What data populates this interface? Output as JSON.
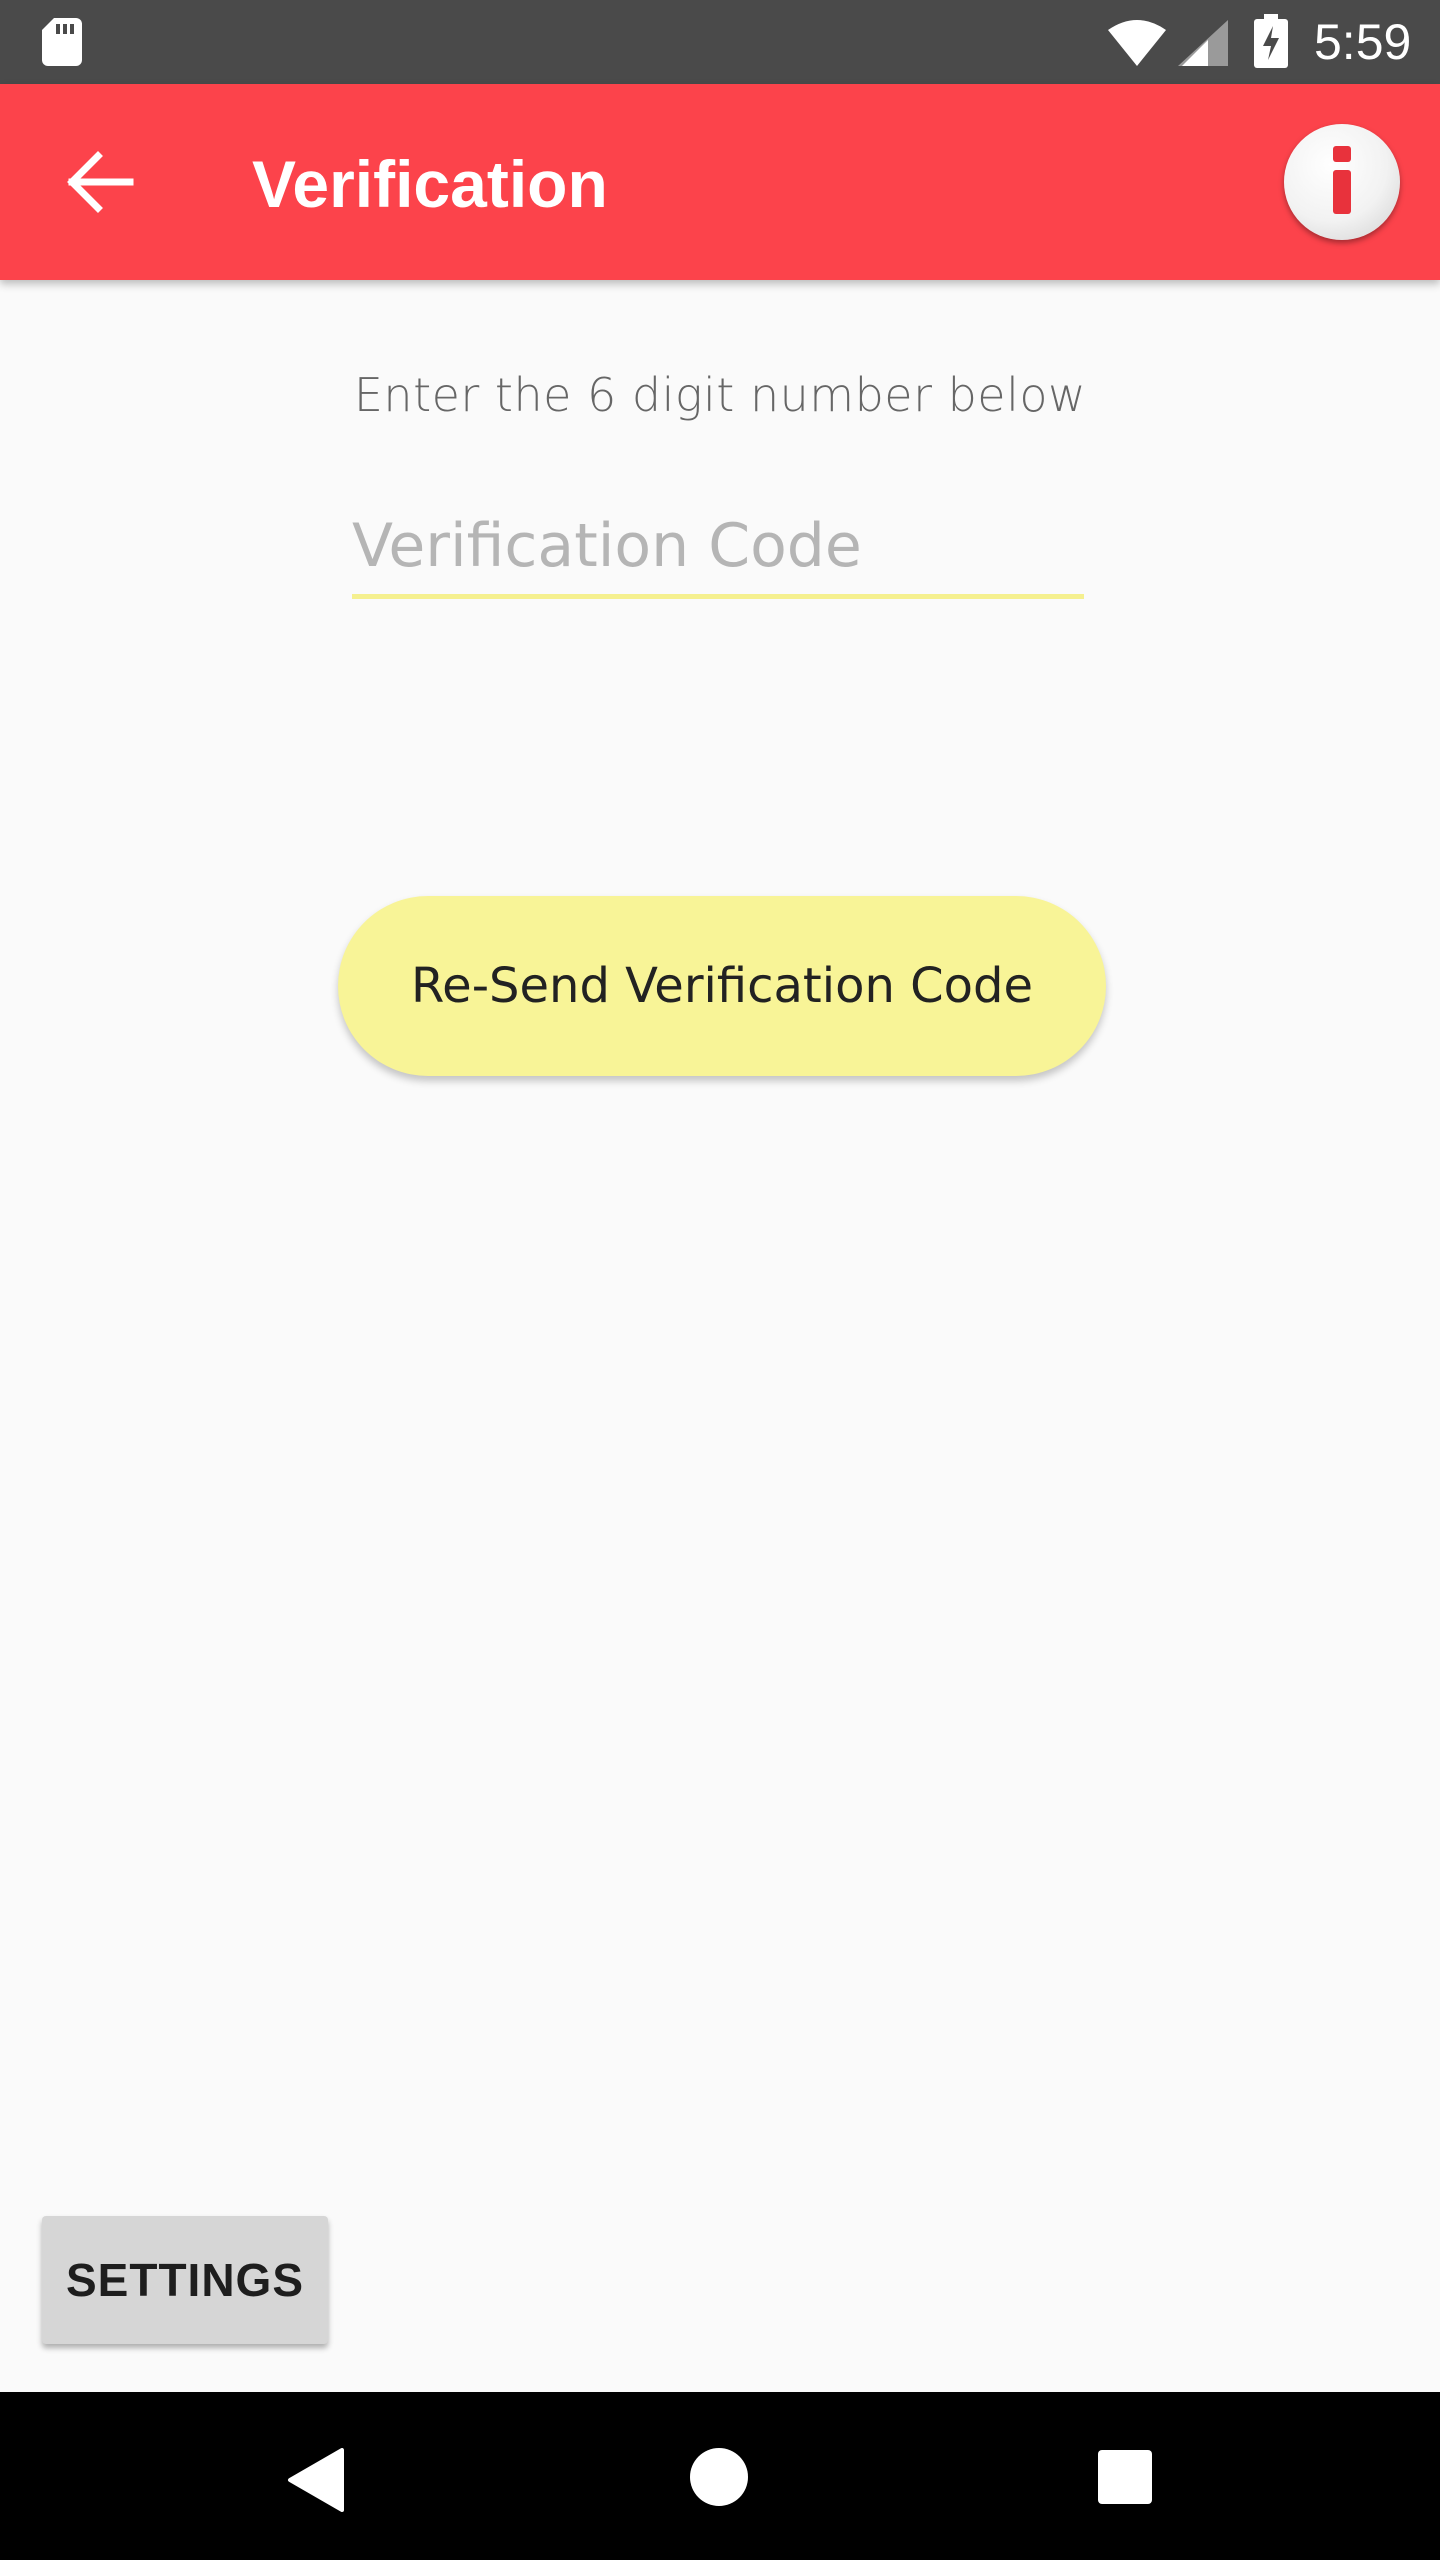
{
  "status_bar": {
    "time": "5:59",
    "icons": [
      "sd-card-icon",
      "wifi-icon",
      "cell-signal-icon",
      "battery-charging-icon"
    ]
  },
  "app_bar": {
    "title": "Verification",
    "back_icon": "arrow-back-icon",
    "info_icon": "info-icon",
    "background_color": "#fc434b"
  },
  "main": {
    "instruction": "Enter the 6 digit number below",
    "code_input": {
      "placeholder": "Verification Code",
      "value": ""
    },
    "resend_button_label": "Re-Send Verification Code",
    "accent_color": "#f8f497"
  },
  "footer": {
    "settings_label": "SETTINGS"
  },
  "nav_bar": {
    "icons": [
      "nav-back-icon",
      "nav-home-icon",
      "nav-recents-icon"
    ]
  }
}
